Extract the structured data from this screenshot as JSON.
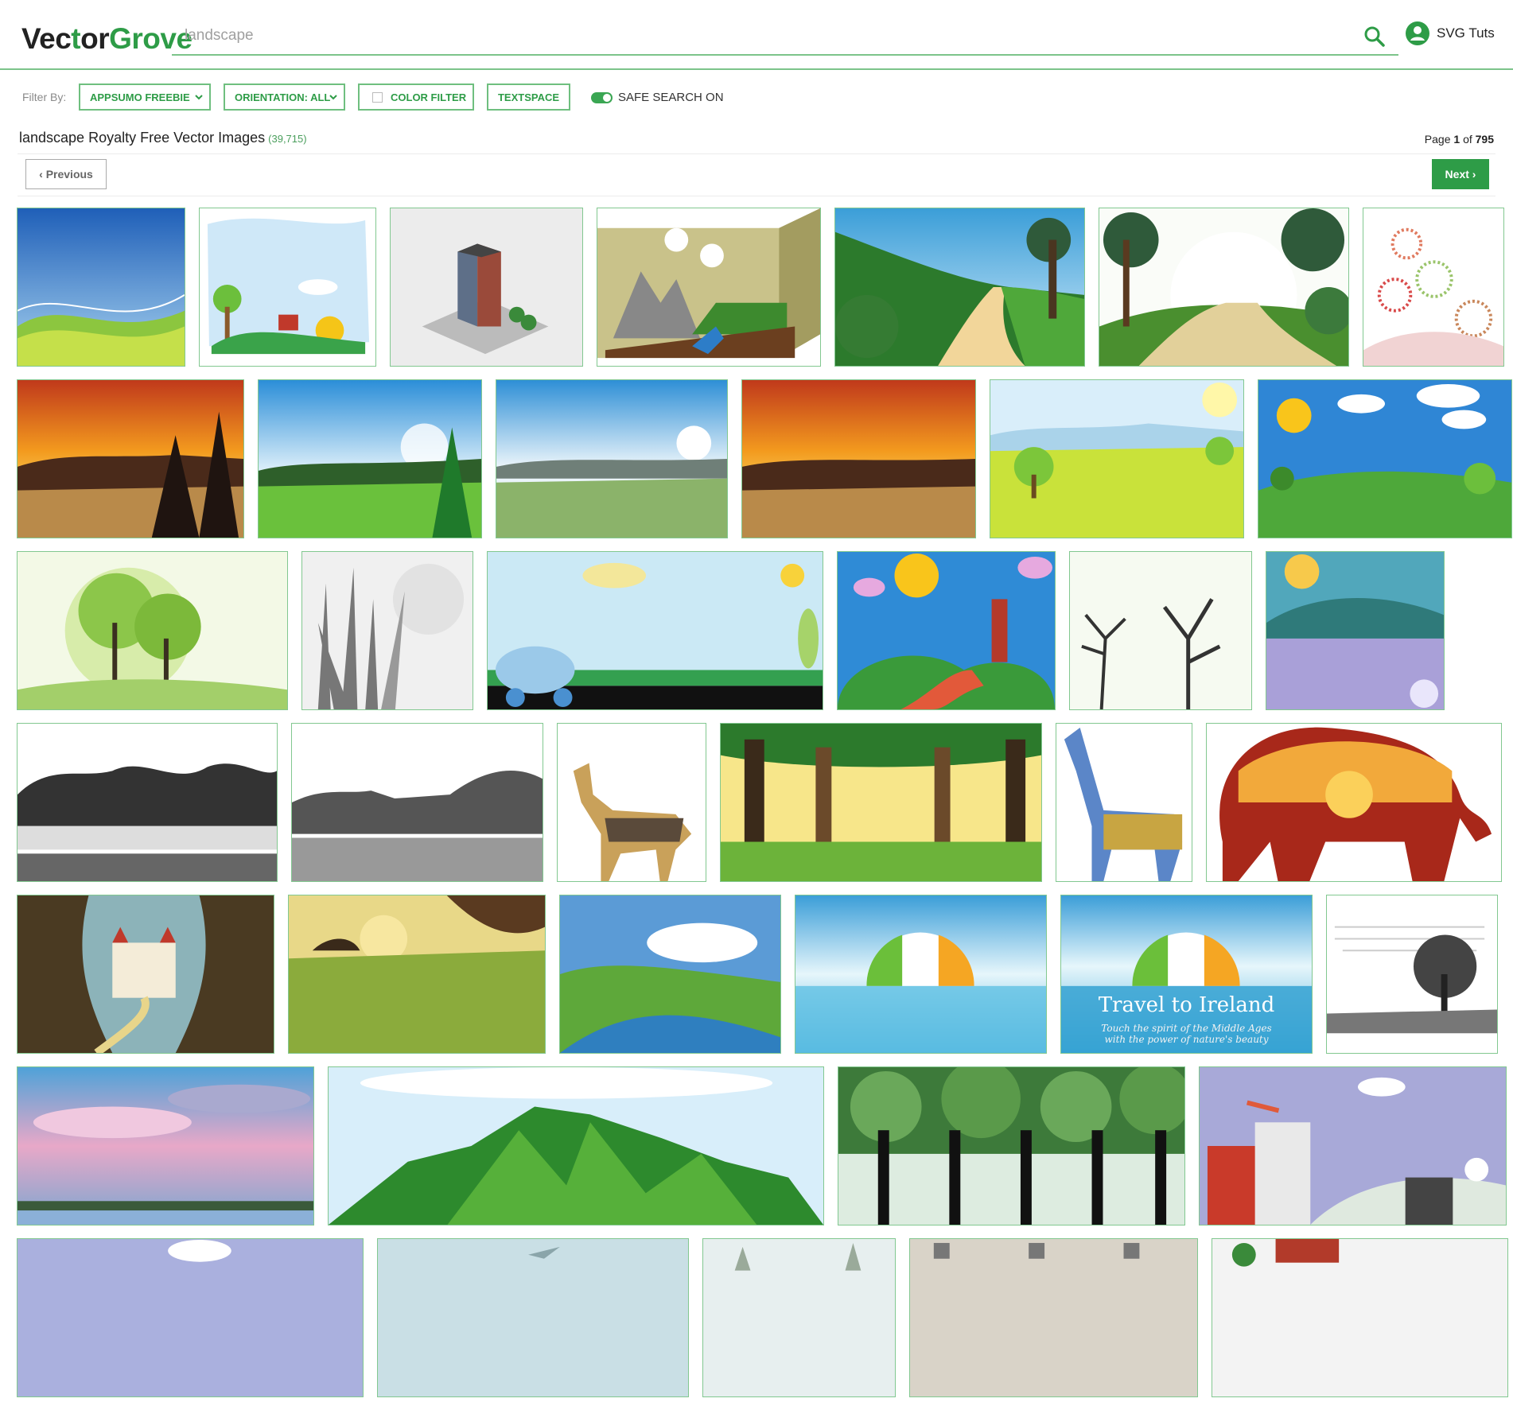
{
  "header": {
    "logo_part1": "Vec",
    "logo_part2": "t",
    "logo_part3": "or",
    "logo_part4": "Grove",
    "search_placeholder": "landscape",
    "search_value": "",
    "user_name": "SVG Tuts"
  },
  "filters": {
    "label": "Filter By:",
    "appsumo": "APPSUMO FREEBIE",
    "orientation": "ORIENTATION: ALL",
    "color_filter": "COLOR FILTER",
    "textspace": "TEXTSPACE",
    "safe_search": "SAFE SEARCH ON"
  },
  "results": {
    "title": "landscape Royalty Free Vector Images",
    "count": "(39,715)",
    "page_prefix": "Page",
    "page_current": "1",
    "page_of": "of",
    "page_total": "795",
    "prev_label": "‹ Previous",
    "next_label": "Next ›"
  },
  "thumbs": {
    "ireland_title": "Travel to Ireland",
    "ireland_sub1": "Touch the spirit of the Middle Ages",
    "ireland_sub2": "with the power of nature's beauty"
  },
  "colors": {
    "brand_green": "#2e9c47",
    "border_green": "#82c890"
  }
}
